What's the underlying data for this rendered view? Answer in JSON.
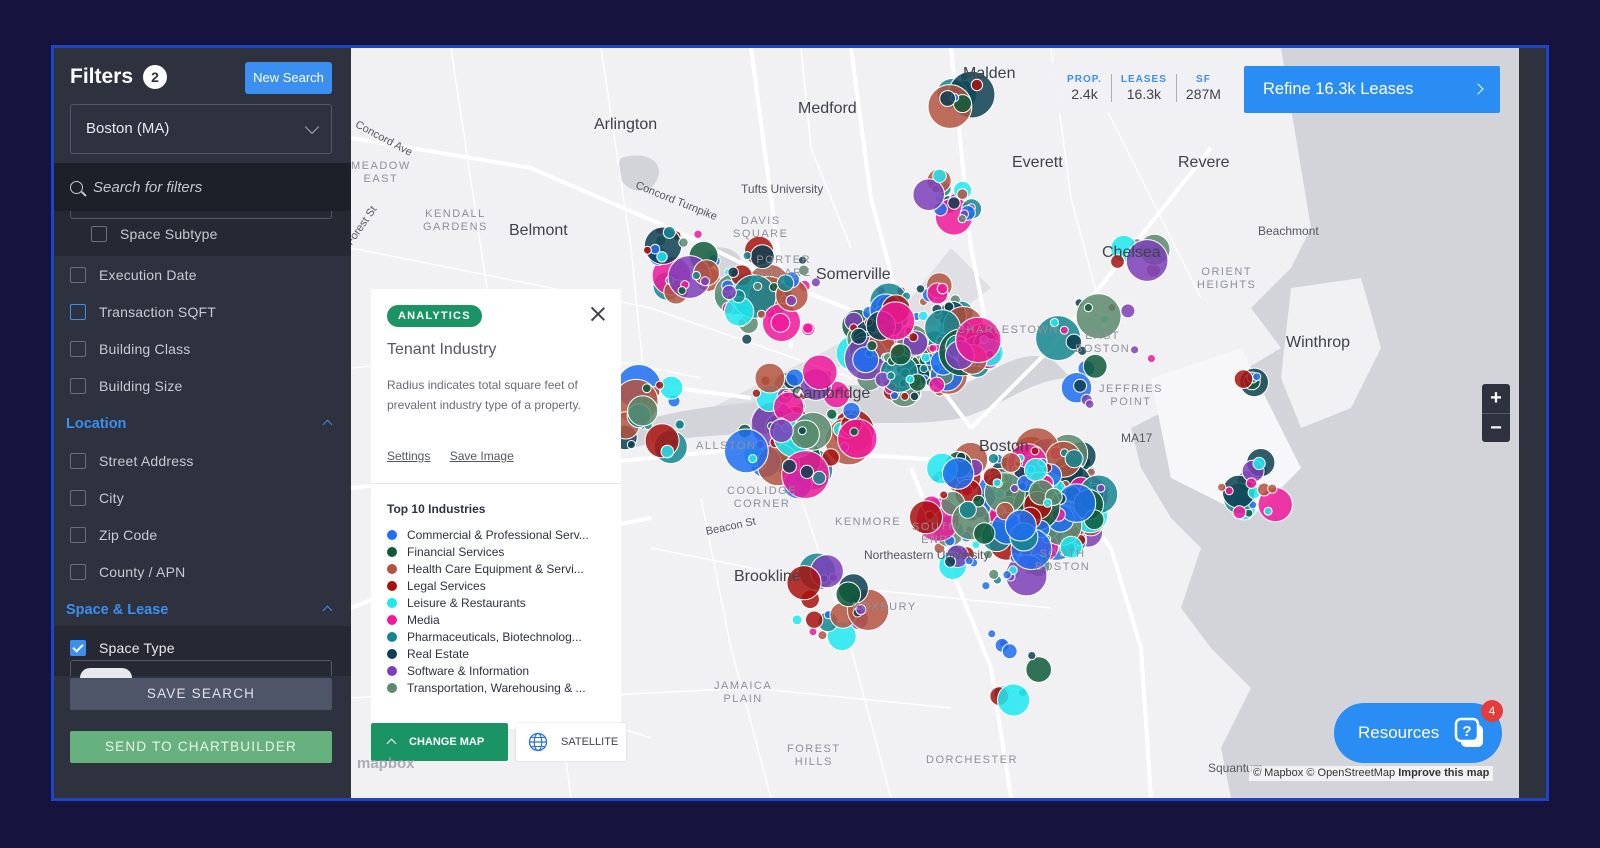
{
  "sidebar": {
    "title": "Filters",
    "filter_count": "2",
    "new_search_label": "New Search",
    "market": "Boston (MA)",
    "search_placeholder": "Search for filters",
    "items": [
      {
        "label": "Space Subtype",
        "checked": false
      },
      {
        "label": "Execution Date",
        "checked": false
      },
      {
        "label": "Transaction SQFT",
        "checked": false
      },
      {
        "label": "Building Class",
        "checked": false
      },
      {
        "label": "Building Size",
        "checked": false
      }
    ],
    "sections": [
      {
        "label": "Location",
        "items": [
          "Street Address",
          "City",
          "Zip Code",
          "County / APN"
        ]
      },
      {
        "label": "Space & Lease",
        "items": [
          "Space Type"
        ]
      }
    ],
    "save_search_label": "SAVE SEARCH",
    "send_chartbuilder_label": "SEND TO CHARTBUILDER"
  },
  "stats": {
    "properties": {
      "label": "PROP.",
      "value": "2.4k"
    },
    "leases": {
      "label": "LEASES",
      "value": "16.3k"
    },
    "sf": {
      "label": "SF",
      "value": "287M"
    }
  },
  "refine_label": "Refine 16.3k Leases",
  "analytics_panel": {
    "badge": "ANALYTICS",
    "title": "Tenant Industry",
    "description": "Radius indicates total square feet of prevalent industry type of a property.",
    "settings_link": "Settings",
    "save_image_link": "Save Image",
    "top_heading": "Top 10 Industries",
    "industries": [
      {
        "name": "Commercial & Professional Serv...",
        "color": "#1f6ff0"
      },
      {
        "name": "Financial Services",
        "color": "#0f5a3a"
      },
      {
        "name": "Health Care Equipment & Servi...",
        "color": "#b4533f"
      },
      {
        "name": "Legal Services",
        "color": "#a8120e"
      },
      {
        "name": "Leisure & Restaurants",
        "color": "#1ee9f0"
      },
      {
        "name": "Media",
        "color": "#f0199a"
      },
      {
        "name": "Pharmaceuticals, Biotechnolog...",
        "color": "#14868f"
      },
      {
        "name": "Real Estate",
        "color": "#0d4050"
      },
      {
        "name": "Software & Information",
        "color": "#7d3fb8"
      },
      {
        "name": "Transportation, Warehousing & ...",
        "color": "#5b8a6c"
      }
    ]
  },
  "map": {
    "places": [
      {
        "name": "Malden",
        "cls": "big"
      },
      {
        "name": "Medford",
        "cls": "big"
      },
      {
        "name": "Arlington",
        "cls": "big"
      },
      {
        "name": "Everett",
        "cls": "big"
      },
      {
        "name": "Revere",
        "cls": "big"
      },
      {
        "name": "Tufts University",
        "cls": "mid"
      },
      {
        "name": "Belmont",
        "cls": "big"
      },
      {
        "name": "Somerville",
        "cls": "big"
      },
      {
        "name": "Chelsea",
        "cls": "big"
      },
      {
        "name": "Beachmont",
        "cls": "mid"
      },
      {
        "name": "Winthrop",
        "cls": "big"
      },
      {
        "name": "Cambridge",
        "cls": "big"
      },
      {
        "name": "Boston",
        "cls": "big"
      },
      {
        "name": "Brookline",
        "cls": "big"
      },
      {
        "name": "KENDALL GARDENS",
        "cls": "small"
      },
      {
        "name": "MEADOW EAST",
        "cls": "small"
      },
      {
        "name": "DAVIS SQUARE",
        "cls": "small"
      },
      {
        "name": "PORTER SQUARE",
        "cls": "small"
      },
      {
        "name": "ORIENT HEIGHTS",
        "cls": "small"
      },
      {
        "name": "CHARLESTOWN",
        "cls": "small"
      },
      {
        "name": "EAST BOSTON",
        "cls": "small"
      },
      {
        "name": "JEFFRIES POINT",
        "cls": "small"
      },
      {
        "name": "ALLSTON",
        "cls": "small"
      },
      {
        "name": "COOLIDGE CORNER",
        "cls": "small"
      },
      {
        "name": "KENMORE",
        "cls": "small"
      },
      {
        "name": "SOUTH END",
        "cls": "small"
      },
      {
        "name": "SOUTH BOSTON",
        "cls": "small"
      },
      {
        "name": "ROXBURY",
        "cls": "small"
      },
      {
        "name": "JAMAICA PLAIN",
        "cls": "small"
      },
      {
        "name": "FOREST HILLS",
        "cls": "small"
      },
      {
        "name": "DORCHESTER",
        "cls": "small"
      },
      {
        "name": "Northeastern University",
        "cls": "mid"
      },
      {
        "name": "Squantum",
        "cls": "mid"
      },
      {
        "name": "MA17",
        "cls": "mid"
      },
      {
        "name": "Concord Turnpike",
        "cls": "mid"
      },
      {
        "name": "Concord Ave",
        "cls": "mid"
      },
      {
        "name": "Forest St",
        "cls": "mid"
      },
      {
        "name": "Beacon St",
        "cls": "mid"
      }
    ]
  },
  "zoom_in": "+",
  "zoom_out": "−",
  "change_map_label": "CHANGE MAP",
  "satellite_label": "SATELLITE",
  "mapbox_logo": "mapbox",
  "resources_label": "Resources",
  "resources_badge": "4",
  "attribution": {
    "text": "© Mapbox © OpenStreetMap",
    "improve": "Improve this map"
  }
}
